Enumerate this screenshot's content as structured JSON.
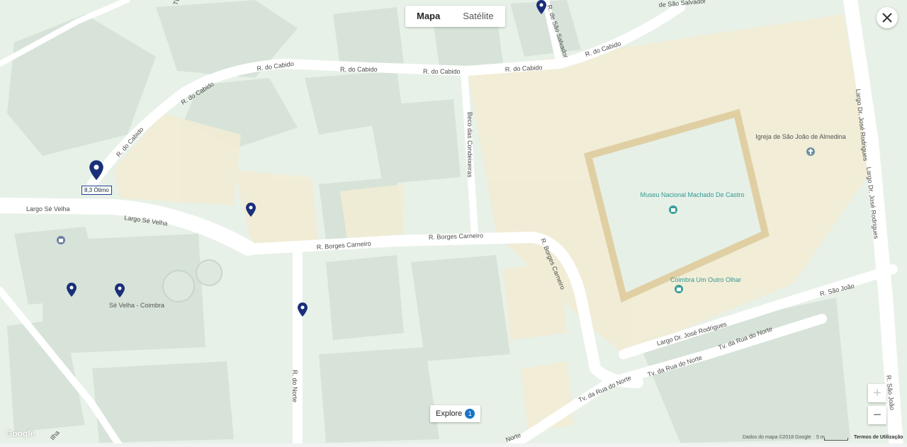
{
  "map_type_toggle": {
    "map_label": "Mapa",
    "satellite_label": "Satélite"
  },
  "streets": [
    "R. do Cabido",
    "R. do Cabido",
    "R. do Cabido",
    "R. do Cabido",
    "R. do Cabido",
    "R. do Cabido",
    "R. do Cabido",
    "de São Salvador",
    "R. de São Salvador",
    "Beco das Condeixeiras",
    "Largo Sé Velha",
    "Largo Sé Velha",
    "R. Borges Carneiro",
    "R. Borges Carneiro",
    "R. Borges Carneiro",
    "R. do Norte",
    "Largo Dr. José Rodrigues",
    "Largo Dr. José Rodrigues",
    "Largo Dr. José Rodrigues",
    "R. São João",
    "R. São João",
    "Tv. da Rua do Norte",
    "Tv. da Rua do Norte",
    "Tv. da Rua do Norte",
    "Norte",
    "Ilha",
    "Tv."
  ],
  "places": {
    "igreja": "Igreja de São João de Almedina",
    "museu": "Museu Nacional Machado De Castro",
    "coimbra_olhar": "Coimbra Um Outro Olhar",
    "se_velha": "Sé Velha - Coimbra"
  },
  "hotel_score_label": "8,3 Ótimo",
  "explore": {
    "label": "Explore",
    "count": "1"
  },
  "zoom": {
    "in": "+",
    "out": "−"
  },
  "footer": {
    "google": "Google",
    "map_data": "Dados do mapa ©2018 Google",
    "scale": "5 m",
    "terms": "Termos de Utilização"
  },
  "colors": {
    "background": "#e8f1e8",
    "road": "#ffffff",
    "building": "#d6e2d6",
    "highlight": "#f3ecd3",
    "pin": "#1a2f7a",
    "poi_teal": "#3a9f98"
  },
  "icons": [
    "close-icon",
    "map-pin-icon",
    "museum-icon",
    "zoom-in-icon",
    "zoom-out-icon"
  ]
}
